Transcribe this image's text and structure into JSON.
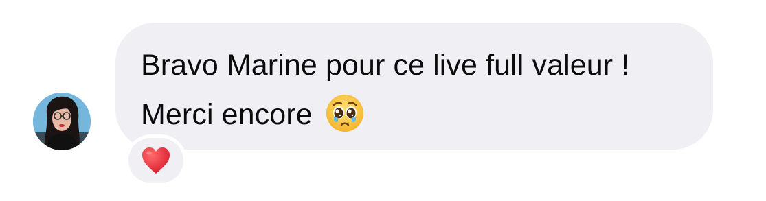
{
  "message": {
    "line1": "Bravo Marine pour ce live full valeur !",
    "line2": "Merci encore",
    "emoji_icon": "pleading-face-icon"
  },
  "reaction": {
    "icon": "red-heart-icon"
  },
  "sender": {
    "avatar_icon": "user-avatar"
  },
  "colors": {
    "bubble": "#efeff4",
    "text": "#0b0b0b",
    "heart": "#e2263a",
    "background": "#ffffff"
  }
}
